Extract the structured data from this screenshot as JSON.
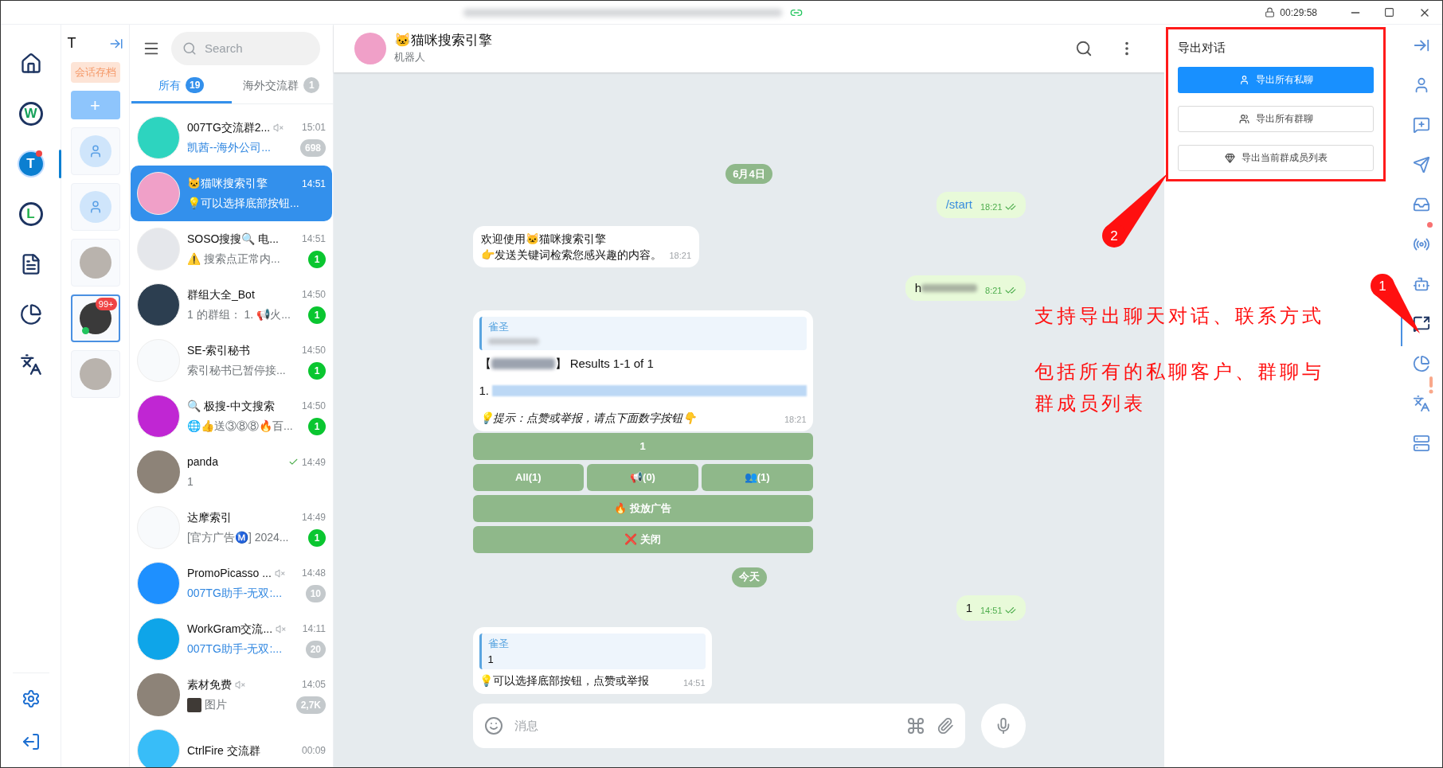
{
  "title_bar": {
    "timer": "00:29:58"
  },
  "left_rail": {
    "items": [
      {
        "kind": "home",
        "selected": false
      },
      {
        "kind": "letter",
        "label": "W",
        "color": "#15a05a",
        "selected": false
      },
      {
        "kind": "letter_filled",
        "label": "T",
        "color": "#0b7fd1",
        "badge": true,
        "selected": true
      },
      {
        "kind": "letter",
        "label": "L",
        "color": "#22b14c",
        "selected": false
      },
      {
        "kind": "document",
        "selected": false
      },
      {
        "kind": "pie",
        "selected": false
      },
      {
        "kind": "translate",
        "selected": false
      }
    ],
    "footer": [
      {
        "kind": "settings"
      },
      {
        "kind": "logout"
      }
    ]
  },
  "accounts": {
    "title": "T",
    "archive_label": "会话存档",
    "add_label": "+",
    "items": [
      {
        "kind": "placeholder",
        "selected": false,
        "online": false
      },
      {
        "kind": "placeholder",
        "selected": false,
        "online": false
      },
      {
        "kind": "photo",
        "selected": false,
        "online": false
      },
      {
        "kind": "photo",
        "selected": true,
        "badge": "99+",
        "online": true
      },
      {
        "kind": "photo",
        "selected": false,
        "online": false
      }
    ]
  },
  "chat_list": {
    "search_placeholder": "Search",
    "tabs": [
      {
        "label": "所有",
        "count": "19",
        "selected": true
      },
      {
        "label": "海外交流群",
        "count": "1",
        "selected": false
      }
    ],
    "chats": [
      {
        "name": "007TG交流群2...",
        "time": "15:01",
        "preview": "凯茜--海外公司...",
        "badge": "698",
        "muted": true,
        "read": false,
        "highlight": true,
        "selected": false,
        "photo": false,
        "color": "#2dd4bf"
      },
      {
        "name": "🐱猫咪搜索引擎",
        "time": "14:51",
        "preview": "💡可以选择底部按钮...",
        "muted": false,
        "read": false,
        "highlight": false,
        "selected": true,
        "photo": false,
        "color": "#f0a0c8"
      },
      {
        "name": "SOSO搜搜🔍 电...",
        "time": "14:51",
        "preview": "⚠️ 搜索点正常内...",
        "badge": "1",
        "muted": false,
        "read": false,
        "highlight": false,
        "selected": false,
        "photo": false,
        "color": "#e5e7eb"
      },
      {
        "name": "群组大全_Bot",
        "time": "14:50",
        "preview": "1 的群组： 1. 📢火...",
        "badge": "1",
        "muted": false,
        "read": false,
        "highlight": false,
        "selected": false,
        "photo": false,
        "color": "#2c3e50"
      },
      {
        "name": "SE-索引秘书",
        "time": "14:50",
        "preview": "索引秘书已暂停接...",
        "badge": "1",
        "muted": false,
        "read": false,
        "highlight": false,
        "selected": false,
        "photo": false,
        "color": "#f8fafc"
      },
      {
        "name": "🔍 极搜-中文搜索",
        "time": "14:50",
        "preview": "🌐👍送③⑧⑧🔥百...",
        "badge": "1",
        "muted": false,
        "read": false,
        "highlight": false,
        "selected": false,
        "photo": false,
        "color": "#c026d3"
      },
      {
        "name": "panda",
        "time": "14:49",
        "preview": "1",
        "muted": false,
        "read": true,
        "highlight": false,
        "selected": false,
        "photo": true
      },
      {
        "name": "达摩索引",
        "time": "14:49",
        "preview": "[官方广告Ⓜ️] 2024...",
        "badge": "1",
        "muted": false,
        "read": false,
        "highlight": false,
        "selected": false,
        "photo": false,
        "color": "#f8fafc"
      },
      {
        "name": "PromoPicasso ...",
        "time": "14:48",
        "preview": "007TG助手-无双:...",
        "badge": "10",
        "muted": true,
        "read": false,
        "highlight": true,
        "selected": false,
        "photo": false,
        "color": "#1e90ff"
      },
      {
        "name": "WorkGram交流...",
        "time": "14:11",
        "preview": "007TG助手-无双:...",
        "badge": "20",
        "muted": true,
        "read": false,
        "highlight": true,
        "selected": false,
        "photo": false,
        "color": "#0ea5e9"
      },
      {
        "name": "素材免费",
        "time": "14:05",
        "preview": "图片",
        "badge": "2,7K",
        "muted": true,
        "read": false,
        "highlight": false,
        "thumbnail": true,
        "selected": false,
        "photo": true
      },
      {
        "name": "CtrlFire 交流群",
        "time": "00:09",
        "muted": false,
        "read": false,
        "selected": false,
        "photo": false,
        "color": "#38bdf8"
      }
    ]
  },
  "chat": {
    "title": "🐱猫咪搜索引擎",
    "subtitle": "机器人",
    "messages": [
      {
        "kind": "date",
        "text": "6月4日"
      },
      {
        "kind": "out",
        "text": "/start",
        "command": true,
        "redacted": false,
        "time": "18:21",
        "read": true
      },
      {
        "kind": "in",
        "lines": [
          "欢迎使用🐱猫咪搜索引擎",
          "👉发送关键词检索您感兴趣的内容。"
        ],
        "time": "18:21"
      },
      {
        "kind": "out",
        "text": "h",
        "command": false,
        "redacted": true,
        "time": "8:21",
        "read": true
      },
      {
        "kind": "card",
        "quote_author": "雀圣",
        "title_prefix": "【",
        "title_suffix": "】 Results 1-1 of 1",
        "item_prefix": "1.",
        "hint": "💡提示：点赞或举报，请点下面数字按钮👇",
        "time": "18:21"
      },
      {
        "kind": "keyboard",
        "rows": [
          [
            "1"
          ],
          [
            "All(1)",
            "📢(0)",
            "👥(1)"
          ],
          [
            "🔥 投放广告"
          ],
          [
            "❌ 关闭"
          ]
        ]
      },
      {
        "kind": "date",
        "text": "今天"
      },
      {
        "kind": "out",
        "text": "1",
        "command": false,
        "redacted": false,
        "time": "14:51",
        "read": true
      },
      {
        "kind": "reply",
        "quote_author": "雀圣",
        "quote_text": "1",
        "text": "💡可以选择底部按钮，点赞或举报",
        "time": "14:51"
      }
    ],
    "composer": {
      "placeholder": "消息"
    }
  },
  "export_panel": {
    "title": "导出对话",
    "buttons": [
      {
        "label": "导出所有私聊",
        "kind": "user",
        "primary": true
      },
      {
        "label": "导出所有群聊",
        "kind": "users",
        "primary": false
      },
      {
        "label": "导出当前群成员列表",
        "kind": "gem",
        "primary": false
      }
    ]
  },
  "right_rail": {
    "items": [
      {
        "kind": "collapse",
        "selected": false
      },
      {
        "kind": "user",
        "selected": false
      },
      {
        "kind": "message_plus",
        "selected": false
      },
      {
        "kind": "send",
        "selected": false
      },
      {
        "kind": "inbox",
        "selected": false
      },
      {
        "kind": "broadcast",
        "selected": false,
        "dot": true
      },
      {
        "kind": "robot",
        "selected": false
      },
      {
        "kind": "export",
        "selected": true
      },
      {
        "kind": "chart",
        "selected": false,
        "alert": true
      },
      {
        "kind": "translate",
        "selected": false
      },
      {
        "kind": "server",
        "selected": false
      }
    ]
  },
  "annotations": {
    "callouts": [
      {
        "label": "1"
      },
      {
        "label": "2"
      }
    ],
    "notes": [
      "支持导出聊天对话、联系方式",
      "包括所有的私聊客户、群聊与群成员列表"
    ]
  }
}
